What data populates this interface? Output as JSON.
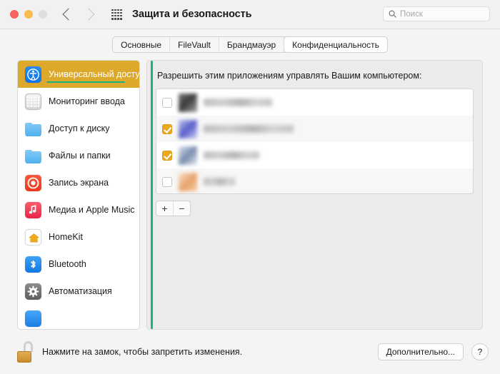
{
  "window": {
    "title": "Защита и безопасность",
    "traffic_lights": [
      "close",
      "minimize",
      "zoom"
    ],
    "grid_icon": "apps-grid-icon",
    "back_icon": "chevron-left-icon",
    "forward_icon": "chevron-right-icon"
  },
  "search": {
    "placeholder": "Поиск",
    "value": "",
    "icon": "search-icon"
  },
  "tabs": [
    {
      "label": "Основные",
      "active": false
    },
    {
      "label": "FileVault",
      "active": false
    },
    {
      "label": "Брандмауэр",
      "active": false
    },
    {
      "label": "Конфиденциальность",
      "active": true
    }
  ],
  "sidebar": {
    "items": [
      {
        "label": "Универсальный доступ",
        "icon": "accessibility-icon",
        "selected": true
      },
      {
        "label": "Мониторинг ввода",
        "icon": "keyboard-icon",
        "selected": false
      },
      {
        "label": "Доступ к диску",
        "icon": "folder-icon",
        "selected": false
      },
      {
        "label": "Файлы и папки",
        "icon": "folder-icon",
        "selected": false
      },
      {
        "label": "Запись экрана",
        "icon": "screen-recording-icon",
        "selected": false
      },
      {
        "label": "Медиа и Apple Music",
        "icon": "music-icon",
        "selected": false
      },
      {
        "label": "HomeKit",
        "icon": "homekit-icon",
        "selected": false
      },
      {
        "label": "Bluetooth",
        "icon": "bluetooth-icon",
        "selected": false
      },
      {
        "label": "Автоматизация",
        "icon": "automation-gear-icon",
        "selected": false
      },
      {
        "label": "",
        "icon": "blue-app-icon",
        "selected": false
      }
    ]
  },
  "main": {
    "heading": "Разрешить этим приложениям управлять Вашим компьютером:",
    "rows": [
      {
        "checked": false,
        "name_blurred": true,
        "name_width": 96,
        "icon_color": "dark"
      },
      {
        "checked": true,
        "name_blurred": true,
        "name_width": 126,
        "icon_color": "blue-purple"
      },
      {
        "checked": true,
        "name_blurred": true,
        "name_width": 78,
        "icon_color": "steel-blue"
      },
      {
        "checked": false,
        "name_blurred": true,
        "name_width": 44,
        "icon_color": "orange"
      }
    ],
    "add_button": "+",
    "remove_button": "−"
  },
  "footer": {
    "lock_icon": "unlocked-padlock-icon",
    "lock_text": "Нажмите на замок, чтобы запретить изменения.",
    "advanced_label": "Дополнительно...",
    "help_label": "?"
  },
  "annotations": {
    "highlight_color": "#dda92b",
    "underline_color": "#17b583",
    "checkbox_color": "#e9a91f",
    "line_color": "#17b583"
  }
}
